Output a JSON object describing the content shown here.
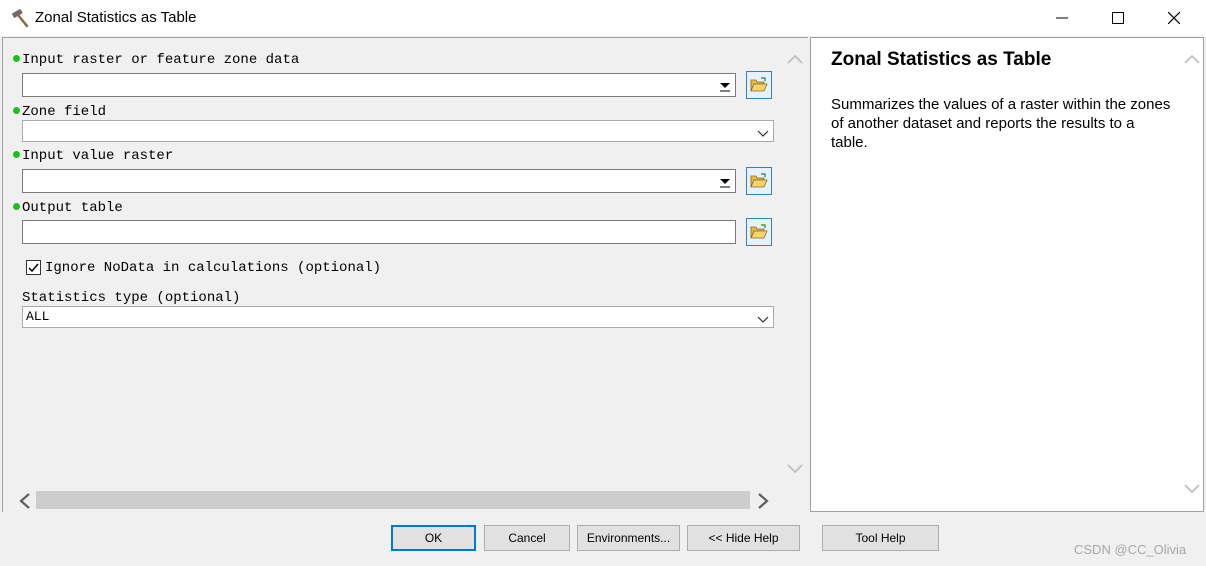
{
  "window": {
    "title": "Zonal Statistics as Table"
  },
  "form": {
    "input_raster_label": "Input raster or feature zone data",
    "input_raster_value": "",
    "zone_field_label": "Zone field",
    "zone_field_value": "",
    "input_value_raster_label": "Input value raster",
    "input_value_raster_value": "",
    "output_table_label": "Output table",
    "output_table_value": "",
    "ignore_nodata_label": "Ignore NoData in calculations (optional)",
    "ignore_nodata_checked": true,
    "statistics_type_label": "Statistics type (optional)",
    "statistics_type_value": "ALL"
  },
  "help": {
    "title": "Zonal Statistics as Table",
    "body": "Summarizes the values of a raster within the zones of another dataset and reports the results to a table."
  },
  "buttons": {
    "ok": "OK",
    "cancel": "Cancel",
    "environments": "Environments...",
    "hide_help": "<< Hide Help",
    "tool_help": "Tool Help"
  },
  "watermark": "CSDN @CC_Olivia",
  "colors": {
    "required_dot": "#1fbf1f",
    "primary_button_border": "#0078d7",
    "browse_button_border": "#3c7fb1"
  },
  "icons": {
    "title": "hammer-icon",
    "browse": "folder-open-icon"
  }
}
